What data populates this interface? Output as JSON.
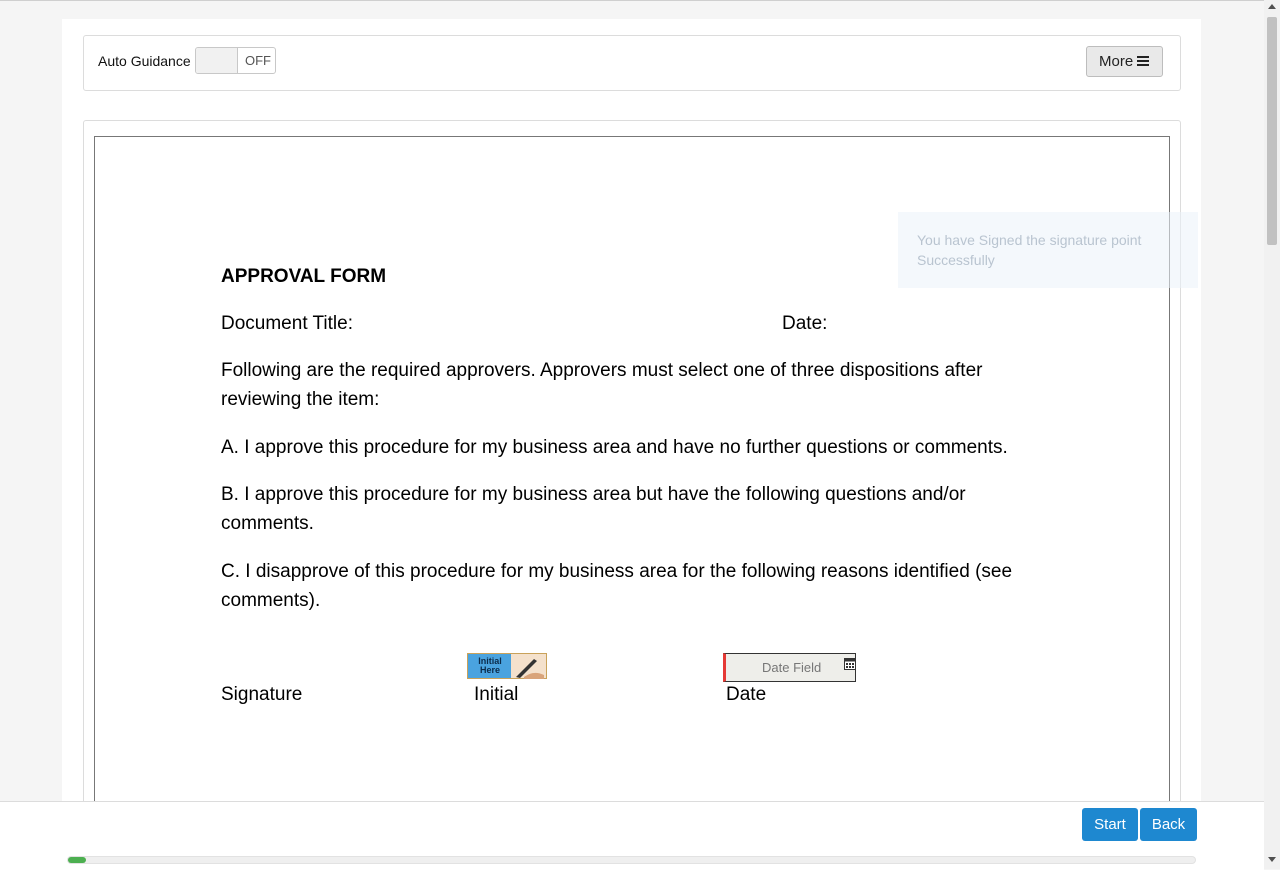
{
  "toolbar": {
    "auto_guidance_label": "Auto Guidance",
    "toggle_state": "OFF",
    "more_label": "More",
    "more_icon": "bars-icon"
  },
  "toast": {
    "message": "You have Signed the signature point Successfully"
  },
  "document": {
    "heading": "APPROVAL FORM",
    "document_title_label": "Document Title:",
    "date_label": "Date:",
    "intro": "Following are the required approvers. Approvers must select one of three dispositions after reviewing the item:",
    "option_a": "A. I approve this procedure for my business area and have no further questions or comments.",
    "option_b": "B. I approve this procedure for my business area but have the following questions and/or comments.",
    "option_c": "C. I disapprove of this procedure for my business area for the following reasons identified (see comments).",
    "signature_label": "Signature",
    "initial_label": "Initial",
    "date_column_label": "Date"
  },
  "fields": {
    "initial_here_text": "Initial Here",
    "date_field_placeholder": "Date Field",
    "date_field_icon": "calendar-icon",
    "date_field_required_color": "#e53935"
  },
  "footer": {
    "start_label": "Start",
    "back_label": "Back",
    "progress": 0.016,
    "accent_color": "#1e88d0",
    "progress_color": "#4caf50"
  }
}
